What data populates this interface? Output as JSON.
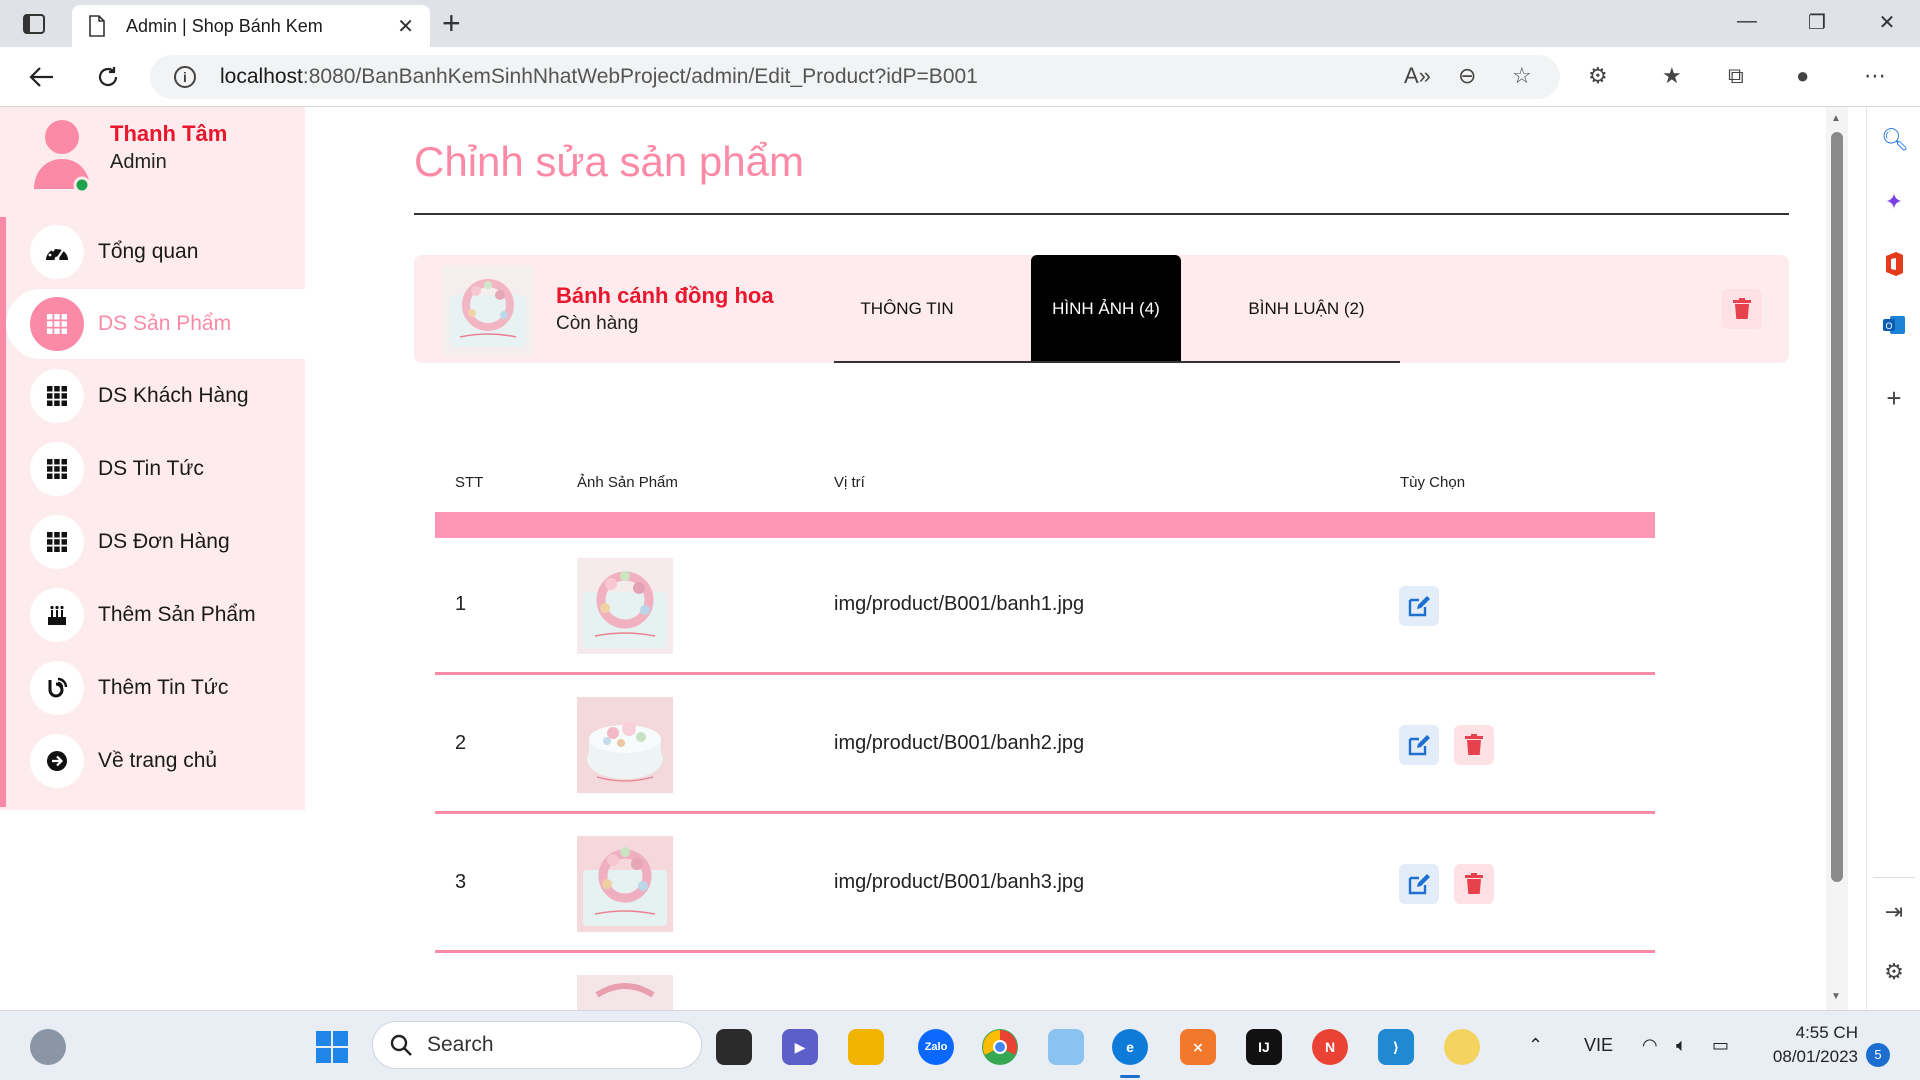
{
  "browser": {
    "tab_title": "Admin | Shop Bánh Kem",
    "url_host": "localhost",
    "url_rest": ":8080/BanBanhKemSinhNhatWebProject/admin/Edit_Product?idP=B001"
  },
  "sidebar": {
    "user_name": "Thanh Tâm",
    "user_role": "Admin",
    "items": [
      {
        "label": "Tổng quan",
        "icon": "dashboard-icon"
      },
      {
        "label": "DS Sản Phẩm",
        "icon": "grid-icon"
      },
      {
        "label": "DS Khách Hàng",
        "icon": "grid-icon"
      },
      {
        "label": "DS Tin Tức",
        "icon": "grid-icon"
      },
      {
        "label": "DS Đơn Hàng",
        "icon": "grid-icon"
      },
      {
        "label": "Thêm Sản Phẩm",
        "icon": "cake-icon"
      },
      {
        "label": "Thêm Tin Tức",
        "icon": "blog-icon"
      },
      {
        "label": "Về trang chủ",
        "icon": "arrow-right-circle-icon"
      }
    ],
    "active_index": 1
  },
  "main": {
    "page_title": "Chỉnh sửa sản phẩm",
    "product": {
      "name": "Bánh cánh đồng hoa",
      "status": "Còn hàng"
    },
    "tabs": [
      {
        "label": "THÔNG TIN"
      },
      {
        "label": "HÌNH ẢNH (4)"
      },
      {
        "label": "BÌNH LUẬN (2)"
      }
    ],
    "active_tab": 1,
    "table": {
      "headers": [
        "STT",
        "Ảnh Sản Phẩm",
        "Vị trí",
        "Tùy Chọn"
      ],
      "rows": [
        {
          "stt": "1",
          "path": "img/product/B001/banh1.jpg"
        },
        {
          "stt": "2",
          "path": "img/product/B001/banh2.jpg"
        },
        {
          "stt": "3",
          "path": "img/product/B001/banh3.jpg"
        }
      ]
    }
  },
  "taskbar": {
    "search_label": "Search",
    "language": "VIE",
    "time": "4:55 CH",
    "date": "08/01/2023",
    "notification_count": "5"
  },
  "colors": {
    "accent_pink": "#fb8aa7",
    "name_red": "#e8172e",
    "sidebar_bg": "#fdebed"
  }
}
